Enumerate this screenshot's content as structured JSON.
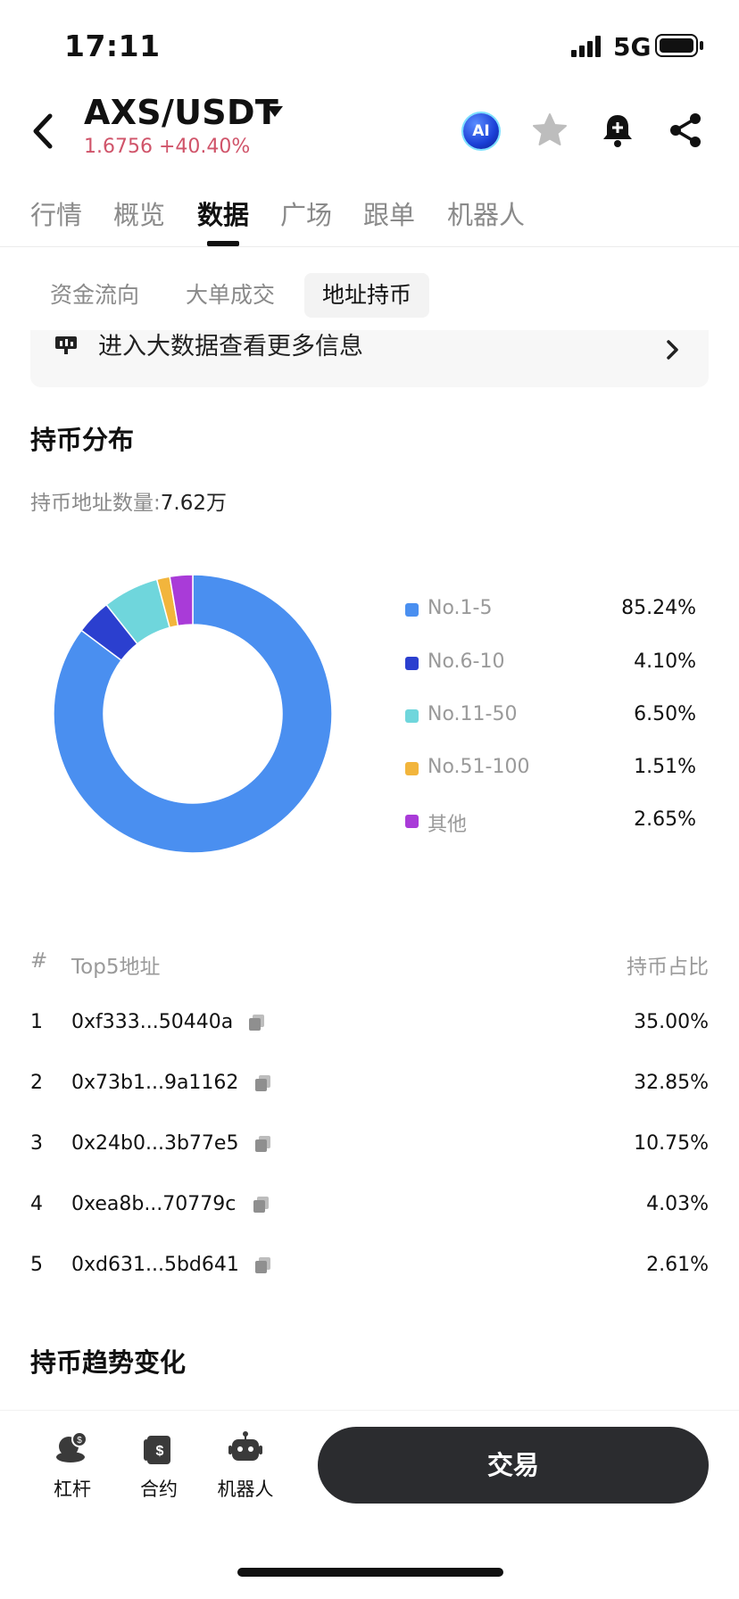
{
  "status_bar": {
    "time": "17:11",
    "network": "5G"
  },
  "header": {
    "pair": "AXS/USDT",
    "price_change": "1.6756 +40.40%",
    "ai_label": "AI"
  },
  "tabs": [
    "行情",
    "概览",
    "数据",
    "广场",
    "跟单",
    "机器人"
  ],
  "active_tab": "数据",
  "subtabs": [
    "资金流向",
    "大单成交",
    "地址持币"
  ],
  "active_subtab": "地址持币",
  "banner": {
    "text": "进入大数据查看更多信息"
  },
  "distribution": {
    "title": "持币分布",
    "count_label": "持币地址数量:",
    "count_value": "7.62万"
  },
  "chart_data": {
    "type": "pie",
    "categories": [
      "No.1-5",
      "No.6-10",
      "No.11-50",
      "No.51-100",
      "其他"
    ],
    "values": [
      85.24,
      4.1,
      6.5,
      1.51,
      2.65
    ],
    "labels": [
      "85.24%",
      "4.10%",
      "6.50%",
      "1.51%",
      "2.65%"
    ],
    "colors": [
      "#4a8ff0",
      "#2b3fcf",
      "#6fd6dc",
      "#f2b53c",
      "#a93bd8"
    ],
    "donut": true,
    "legend_position": "right"
  },
  "top5": {
    "col_rank": "#",
    "col_address": "Top5地址",
    "col_share": "持币占比",
    "rows": [
      {
        "rank": "1",
        "address": "0xf333...50440a",
        "share": "35.00%"
      },
      {
        "rank": "2",
        "address": "0x73b1...9a1162",
        "share": "32.85%"
      },
      {
        "rank": "3",
        "address": "0x24b0...3b77e5",
        "share": "10.75%"
      },
      {
        "rank": "4",
        "address": "0xea8b...70779c",
        "share": "4.03%"
      },
      {
        "rank": "5",
        "address": "0xd631...5bd641",
        "share": "2.61%"
      }
    ]
  },
  "trend": {
    "title": "持币趋势变化"
  },
  "bottom_bar": {
    "items": [
      {
        "label": "杠杆",
        "icon": "leverage-icon"
      },
      {
        "label": "合约",
        "icon": "contract-icon"
      },
      {
        "label": "机器人",
        "icon": "robot-icon"
      }
    ],
    "trade_label": "交易"
  }
}
